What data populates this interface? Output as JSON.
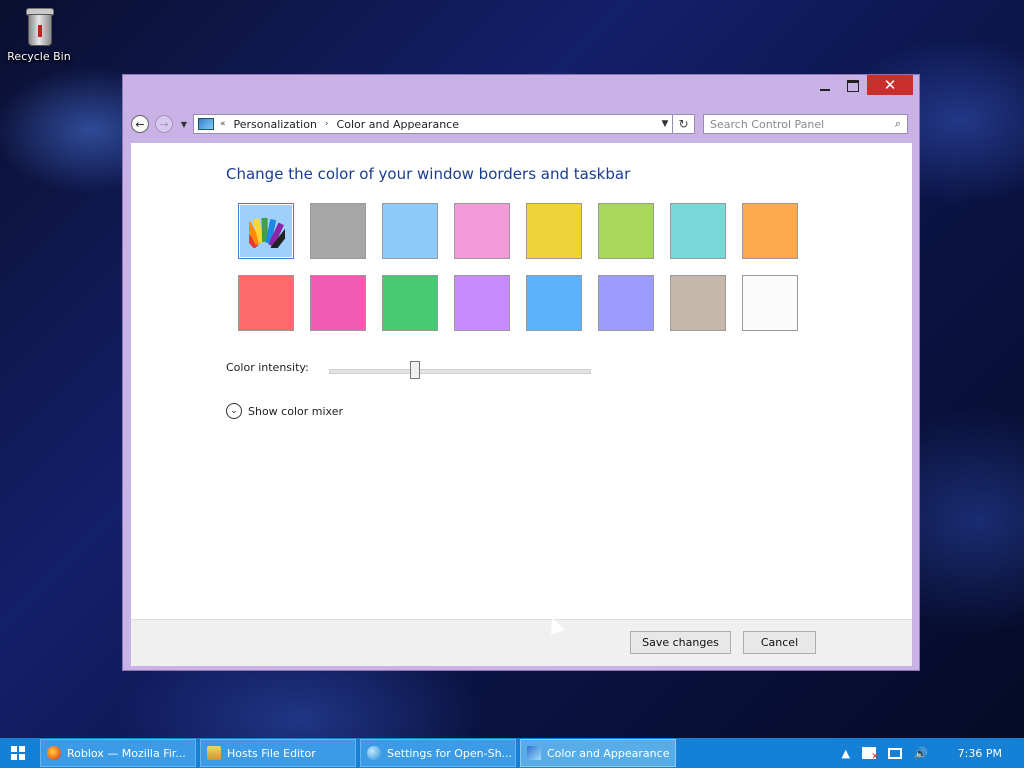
{
  "desktop": {
    "recycle_bin_label": "Recycle Bin"
  },
  "window": {
    "controls": {
      "minimize": "minimize",
      "maximize": "maximize",
      "close": "✕"
    },
    "address": {
      "overflow": "«",
      "crumbs": [
        "Personalization",
        "Color and Appearance"
      ],
      "separator": "›"
    },
    "search_placeholder": "Search Control Panel",
    "heading": "Change the color of your window borders and taskbar",
    "swatches": [
      "automatic",
      "#a6a6a6",
      "#8ecbfb",
      "#f39ad8",
      "#f0d23a",
      "#a8d85a",
      "#7ad8d8",
      "#fda94d",
      "#fe6a6a",
      "#f25bb2",
      "#46cb72",
      "#c88bfb",
      "#5db2fc",
      "#9c9cfc",
      "#c5b8aa",
      "#fbfbfb"
    ],
    "selected_swatch": 0,
    "intensity_label": "Color intensity:",
    "intensity_value": 0.33,
    "show_mixer_label": "Show color mixer",
    "save_label": "Save changes",
    "cancel_label": "Cancel"
  },
  "taskbar": {
    "items": [
      {
        "label": "Roblox — Mozilla Fir...",
        "icon": "firefox-icon",
        "active": false
      },
      {
        "label": "Hosts File Editor",
        "icon": "hosts-file-icon",
        "active": false
      },
      {
        "label": "Settings for Open-Sh...",
        "icon": "globe-icon",
        "active": false
      },
      {
        "label": "Color and Appearance",
        "icon": "control-panel-icon",
        "active": true
      }
    ],
    "tray": {
      "show_hidden": "▲",
      "volume": "🔊",
      "clock": "7:36 PM"
    }
  }
}
